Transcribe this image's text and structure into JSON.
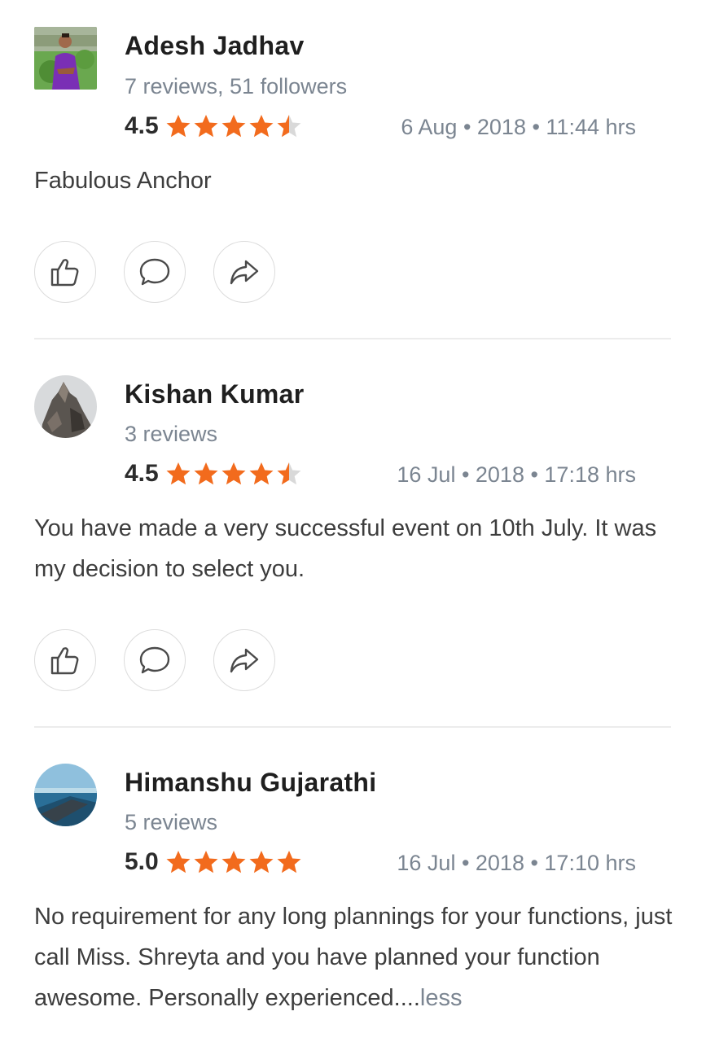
{
  "reviews": [
    {
      "name": "Adesh Jadhav",
      "meta": "7 reviews, 51 followers",
      "rating": "4.5",
      "rating_value": 4.5,
      "date": "6 Aug • 2018 • 11:44 hrs",
      "text": "Fabulous Anchor",
      "avatar_icon": "person-photo"
    },
    {
      "name": "Kishan Kumar",
      "meta": "3 reviews",
      "rating": "4.5",
      "rating_value": 4.5,
      "date": "16 Jul • 2018 • 17:18 hrs",
      "text": "You have made a very successful event on 10th July. It was my decision to select you.",
      "avatar_icon": "rock-photo"
    },
    {
      "name": "Himanshu Gujarathi",
      "meta": "5 reviews",
      "rating": "5.0",
      "rating_value": 5.0,
      "date": "16 Jul • 2018 • 17:10 hrs",
      "text": "No requirement for any long plannings for your functions, just call Miss. Shreyta and you have planned your function awesome. Personally experienced....",
      "less_label": "less",
      "avatar_icon": "sea-photo"
    }
  ],
  "colors": {
    "star": "#f26b1d",
    "star_empty": "#d9d9d9",
    "muted": "#7b8591",
    "icon": "#4a4a4a"
  }
}
